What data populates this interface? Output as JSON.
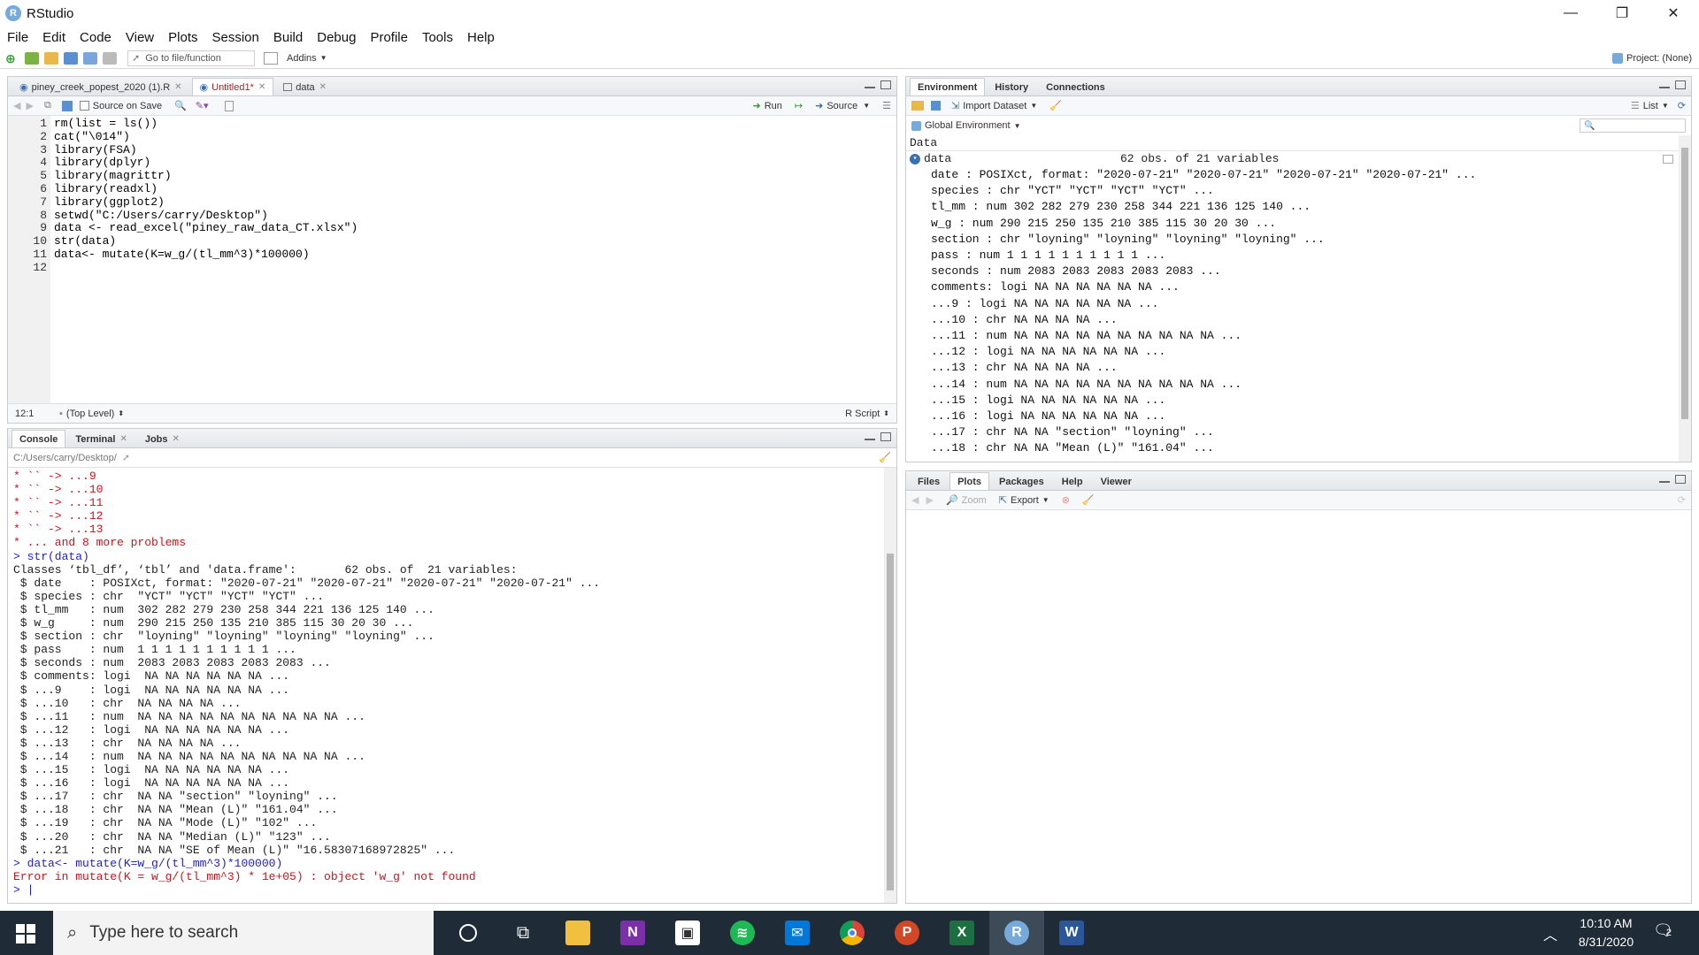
{
  "window": {
    "title": "RStudio",
    "controls": [
      "—",
      "❐",
      "✕"
    ]
  },
  "menu": [
    "File",
    "Edit",
    "Code",
    "View",
    "Plots",
    "Session",
    "Build",
    "Debug",
    "Profile",
    "Tools",
    "Help"
  ],
  "toolbar": {
    "goto_placeholder": "Go to file/function",
    "addins": "Addins",
    "project": "Project: (None)"
  },
  "editor": {
    "tabs": [
      {
        "label": "piney_creek_popest_2020 (1).R"
      },
      {
        "label": "Untitled1*"
      },
      {
        "label": "data"
      }
    ],
    "source_on_save": "Source on Save",
    "run": "Run",
    "source": "Source",
    "line_numbers": [
      "1",
      "2",
      "3",
      "4",
      "5",
      "6",
      "7",
      "8",
      "9",
      "10",
      "11",
      "12"
    ],
    "lines": [
      "rm(list = ls())",
      "cat(\"\\014\")",
      "library(FSA)",
      "library(dplyr)",
      "library(magrittr)",
      "library(readxl)",
      "library(ggplot2)",
      "setwd(\"C:/Users/carry/Desktop\")",
      "data <- read_excel(\"piney_raw_data_CT.xlsx\")",
      "str(data)",
      "data<- mutate(K=w_g/(tl_mm^3)*100000)",
      ""
    ],
    "cursor_pos": "12:1",
    "scope": "(Top Level)",
    "file_type": "R Script"
  },
  "console": {
    "tabs": [
      "Console",
      "Terminal",
      "Jobs"
    ],
    "path": "C:/Users/carry/Desktop/",
    "lines": [
      {
        "t": "* `` -> ...9",
        "c": "red"
      },
      {
        "t": "* `` -> ...10",
        "c": "red"
      },
      {
        "t": "* `` -> ...11",
        "c": "red"
      },
      {
        "t": "* `` -> ...12",
        "c": "red"
      },
      {
        "t": "* `` -> ...13",
        "c": "red"
      },
      {
        "t": "* ... and 8 more problems",
        "c": "red"
      },
      {
        "t": "> str(data)",
        "c": "blue"
      },
      {
        "t": "Classes ‘tbl_df’, ‘tbl’ and 'data.frame':\t62 obs. of  21 variables:",
        "c": ""
      },
      {
        "t": " $ date    : POSIXct, format: \"2020-07-21\" \"2020-07-21\" \"2020-07-21\" \"2020-07-21\" ...",
        "c": ""
      },
      {
        "t": " $ species : chr  \"YCT\" \"YCT\" \"YCT\" \"YCT\" ...",
        "c": ""
      },
      {
        "t": " $ tl_mm   : num  302 282 279 230 258 344 221 136 125 140 ...",
        "c": ""
      },
      {
        "t": " $ w_g     : num  290 215 250 135 210 385 115 30 20 30 ...",
        "c": ""
      },
      {
        "t": " $ section : chr  \"loyning\" \"loyning\" \"loyning\" \"loyning\" ...",
        "c": ""
      },
      {
        "t": " $ pass    : num  1 1 1 1 1 1 1 1 1 1 ...",
        "c": ""
      },
      {
        "t": " $ seconds : num  2083 2083 2083 2083 2083 ...",
        "c": ""
      },
      {
        "t": " $ comments: logi  NA NA NA NA NA NA ...",
        "c": ""
      },
      {
        "t": " $ ...9    : logi  NA NA NA NA NA NA ...",
        "c": ""
      },
      {
        "t": " $ ...10   : chr  NA NA NA NA ...",
        "c": ""
      },
      {
        "t": " $ ...11   : num  NA NA NA NA NA NA NA NA NA NA ...",
        "c": ""
      },
      {
        "t": " $ ...12   : logi  NA NA NA NA NA NA ...",
        "c": ""
      },
      {
        "t": " $ ...13   : chr  NA NA NA NA ...",
        "c": ""
      },
      {
        "t": " $ ...14   : num  NA NA NA NA NA NA NA NA NA NA ...",
        "c": ""
      },
      {
        "t": " $ ...15   : logi  NA NA NA NA NA NA ...",
        "c": ""
      },
      {
        "t": " $ ...16   : logi  NA NA NA NA NA NA ...",
        "c": ""
      },
      {
        "t": " $ ...17   : chr  NA NA \"section\" \"loyning\" ...",
        "c": ""
      },
      {
        "t": " $ ...18   : chr  NA NA \"Mean (L)\" \"161.04\" ...",
        "c": ""
      },
      {
        "t": " $ ...19   : chr  NA NA \"Mode (L)\" \"102\" ...",
        "c": ""
      },
      {
        "t": " $ ...20   : chr  NA NA \"Median (L)\" \"123\" ...",
        "c": ""
      },
      {
        "t": " $ ...21   : chr  NA NA \"SE of Mean (L)\" \"16.58307168972825\" ...",
        "c": ""
      },
      {
        "t": "> data<- mutate(K=w_g/(tl_mm^3)*100000)",
        "c": "blue"
      },
      {
        "t": "Error in mutate(K = w_g/(tl_mm^3) * 1e+05) : object 'w_g' not found",
        "c": "red"
      },
      {
        "t": "> |",
        "c": "blue"
      }
    ]
  },
  "environment": {
    "tabs": [
      "Environment",
      "History",
      "Connections"
    ],
    "import_dataset": "Import Dataset",
    "list_view": "List",
    "scope": "Global Environment",
    "section": "Data",
    "object_name": "data",
    "object_summary": "62 obs. of 21 variables",
    "rows": [
      "date : POSIXct, format: \"2020-07-21\" \"2020-07-21\" \"2020-07-21\" \"2020-07-21\" ...",
      "species : chr \"YCT\" \"YCT\" \"YCT\" \"YCT\" ...",
      "tl_mm : num 302 282 279 230 258 344 221 136 125 140 ...",
      "w_g : num 290 215 250 135 210 385 115 30 20 30 ...",
      "section : chr \"loyning\" \"loyning\" \"loyning\" \"loyning\" ...",
      "pass : num 1 1 1 1 1 1 1 1 1 1 ...",
      "seconds : num 2083 2083 2083 2083 2083 ...",
      "comments: logi NA NA NA NA NA NA ...",
      "...9 : logi NA NA NA NA NA NA ...",
      "...10 : chr NA NA NA NA ...",
      "...11 : num NA NA NA NA NA NA NA NA NA NA ...",
      "...12 : logi NA NA NA NA NA NA ...",
      "...13 : chr NA NA NA NA ...",
      "...14 : num NA NA NA NA NA NA NA NA NA NA ...",
      "...15 : logi NA NA NA NA NA NA ...",
      "...16 : logi NA NA NA NA NA NA ...",
      "...17 : chr NA NA \"section\" \"loyning\" ...",
      "...18 : chr NA NA \"Mean (L)\" \"161.04\" ..."
    ]
  },
  "files": {
    "tabs": [
      "Files",
      "Plots",
      "Packages",
      "Help",
      "Viewer"
    ],
    "zoom": "Zoom",
    "export": "Export"
  },
  "taskbar": {
    "search_placeholder": "Type here to search",
    "time": "10:10 AM",
    "date": "8/31/2020",
    "notifications": "2"
  }
}
